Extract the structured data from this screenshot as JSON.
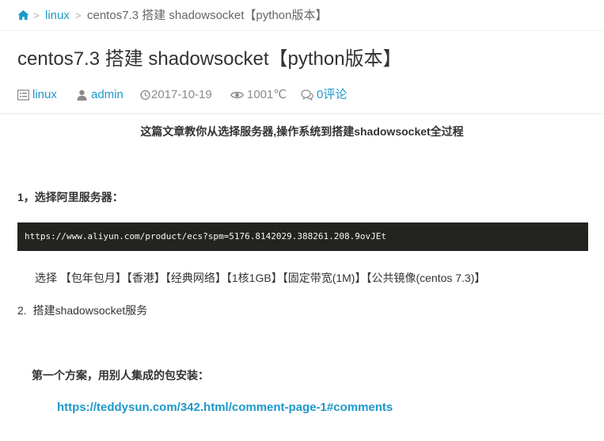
{
  "breadcrumb": {
    "home_icon": "home-icon",
    "separator": ">",
    "category": "linux",
    "current": "centos7.3 搭建 shadowsocket【python版本】"
  },
  "article": {
    "title": "centos7.3 搭建 shadowsocket【python版本】",
    "meta": {
      "category": "linux",
      "author": "admin",
      "date": "2017-10-19",
      "views": "1001℃",
      "comments": "0评论"
    }
  },
  "content": {
    "intro": "这篇文章教你从选择服务器,操作系统到搭建shadowsocket全过程",
    "step1_heading": "1，选择阿里服务器：",
    "code_url": "https://www.aliyun.com/product/ecs?spm=5176.8142029.388261.208.9ovJEt",
    "selection_text": "选择 【包年包月】【香港】【经典网络】【1核1GB】【固定带宽(1M)】【公共镜像(centos 7.3)】",
    "step2_number": "2.",
    "step2_text": "搭建shadowsocket服务",
    "plan1_heading": "第一个方案，用别人集成的包安装：",
    "plan1_link": "https://teddysun.com/342.html/comment-page-1#comments"
  },
  "colors": {
    "link": "#1d98c9",
    "code_bg": "#23241f",
    "meta_gray": "#8a8a8a"
  }
}
